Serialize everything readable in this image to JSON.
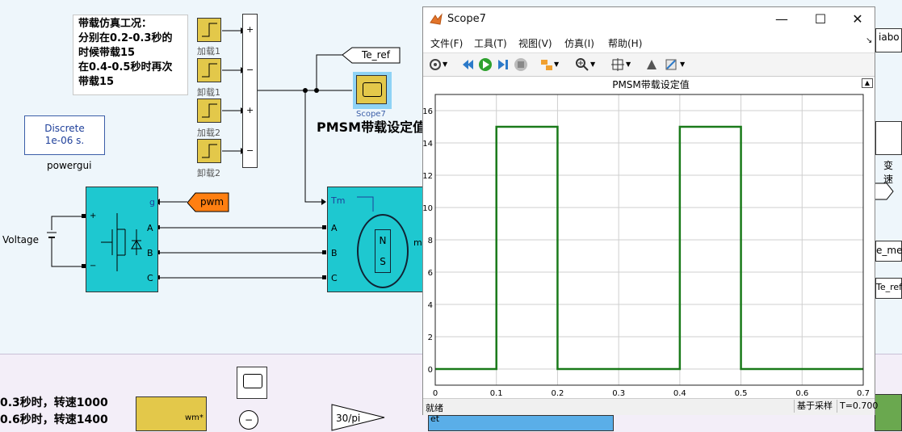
{
  "canvas": {
    "note_lines": [
      "带载仿真工况：",
      "分别在0.2-0.3秒的",
      "时候带载15",
      "在0.4-0.5秒时再次",
      "带载15"
    ],
    "step_labels": [
      "加载1",
      "卸载1",
      "加载2",
      "卸载2"
    ],
    "sum_signs": [
      "+",
      "−",
      "+",
      "−"
    ],
    "discrete_lines": [
      "Discrete",
      "1e-06 s."
    ],
    "powergui_label": "powergui",
    "te_ref_tag": "Te_ref",
    "scope_block_label": "PMSM带载设定值",
    "pwm_tag": "pwm",
    "voltage_label": "Voltage",
    "inverter_port_g": "g",
    "inverter_ports": [
      "A",
      "B",
      "C"
    ],
    "motor_in_ports": [
      "A",
      "B",
      "C"
    ],
    "motor_tm_label": "Tm",
    "motor_m_label": "m",
    "motor_letters": [
      "N",
      "S"
    ],
    "bottom_text": [
      "0.3秒时，转速1000",
      "0.6秒时，转速1400"
    ],
    "wm_label": "wm*",
    "gain_label": "30/pi",
    "right_tags": [
      "iabo",
      "变速",
      "e_me",
      "Te_ref"
    ],
    "et_label": "et",
    "scope_fragment": "Scope7"
  },
  "scope": {
    "title": "Scope7",
    "window_buttons": [
      "—",
      "☐",
      "✕"
    ],
    "menus": [
      "文件(F)",
      "工具(T)",
      "视图(V)",
      "仿真(I)",
      "帮助(H)"
    ],
    "status_left": "就绪",
    "status_sampling": "基于采样",
    "status_time": "T=0.700",
    "accent_line_color": "#1a7a1a"
  },
  "chart_data": {
    "type": "line",
    "title": "PMSM带载设定值",
    "xlabel": "",
    "ylabel": "",
    "xlim": [
      0,
      0.7
    ],
    "ylim": [
      -1,
      17
    ],
    "xticks": [
      0,
      0.1,
      0.2,
      0.3,
      0.4,
      0.5,
      0.6,
      0.7
    ],
    "yticks": [
      0,
      2,
      4,
      6,
      8,
      10,
      12,
      14,
      16
    ],
    "grid": true,
    "series": [
      {
        "color": "#1a7a1a",
        "x": [
          0,
          0.1,
          0.1,
          0.2,
          0.2,
          0.4,
          0.4,
          0.5,
          0.5,
          0.7
        ],
        "y": [
          0,
          0,
          15,
          15,
          0,
          0,
          15,
          15,
          0,
          0
        ]
      }
    ]
  }
}
